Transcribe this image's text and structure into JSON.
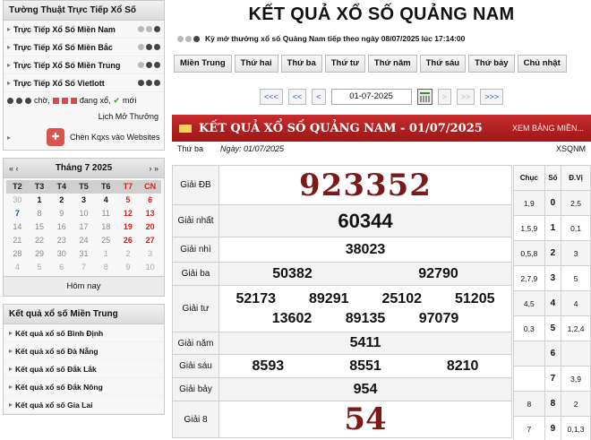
{
  "sidebar": {
    "live": {
      "title": "Tường Thuật Trực Tiếp Xổ Số",
      "items": [
        {
          "label": "Trực Tiếp Xổ Số Miền Nam"
        },
        {
          "label": "Trực Tiếp Xổ Số Miền Bắc"
        },
        {
          "label": "Trực Tiếp Xổ Số Miền Trung"
        },
        {
          "label": "Trực Tiếp Xổ Số Vietlott"
        }
      ],
      "legend_wait": "chờ,",
      "legend_live": "đang xổ,",
      "legend_new": "mới",
      "calendar_link": "Lịch Mở Thưởng",
      "embed_link": "Chèn Kqxs vào Websites"
    },
    "calendar": {
      "month_label": "Tháng 7 2025",
      "prev_year": "«",
      "prev_month": "‹",
      "next_month": "›",
      "next_year": "»",
      "dow": [
        "T2",
        "T3",
        "T4",
        "T5",
        "T6",
        "T7",
        "CN"
      ],
      "rows": [
        [
          "30",
          "1",
          "2",
          "3",
          "4",
          "5",
          "6"
        ],
        [
          "7",
          "8",
          "9",
          "10",
          "11",
          "12",
          "13"
        ],
        [
          "14",
          "15",
          "16",
          "17",
          "18",
          "19",
          "20"
        ],
        [
          "21",
          "22",
          "23",
          "24",
          "25",
          "26",
          "27"
        ],
        [
          "28",
          "29",
          "30",
          "31",
          "1",
          "2",
          "3"
        ],
        [
          "4",
          "5",
          "6",
          "7",
          "8",
          "9",
          "10"
        ]
      ],
      "today_button": "Hôm nay"
    },
    "mien_trung": {
      "title": "Kết quả xổ số Miền Trung",
      "items": [
        "Kết quả xổ số Bình Định",
        "Kết quả xổ số Đà Nẵng",
        "Kết quả xổ số Đắk Lắk",
        "Kết quả xổ số Đắk Nông",
        "Kết quả xổ số Gia Lai"
      ]
    }
  },
  "main": {
    "title": "KẾT QUẢ XỔ SỐ QUẢNG NAM",
    "info_text": "Kỳ mở thưởng xổ số Quảng Nam tiếp theo ngày 08/07/2025 lúc 17:14:00",
    "tabs": [
      "Miền Trung",
      "Thứ hai",
      "Thứ ba",
      "Thứ tư",
      "Thứ năm",
      "Thứ sáu",
      "Thứ bảy",
      "Chủ nhật"
    ],
    "pager": {
      "first": "<<<",
      "prev": "<<",
      "prev1": "<",
      "date_value": "01-07-2025",
      "next1": ">",
      "next": ">>",
      "last": ">>>"
    },
    "banner_title": "KẾT QUẢ XỔ SỐ QUẢNG NAM - 01/07/2025",
    "banner_link": "XEM BẢNG MIỀN...",
    "day": "Thứ ba",
    "date_text": "Ngày: 01/07/2025",
    "code": "XSQNM",
    "prizes": {
      "db": {
        "name": "Giải ĐB",
        "value": "923352"
      },
      "nhat": {
        "name": "Giải nhất",
        "value": "60344"
      },
      "nhi": {
        "name": "Giải nhì",
        "value": "38023"
      },
      "ba": {
        "name": "Giải ba",
        "values": [
          "50382",
          "92790"
        ]
      },
      "tu": {
        "name": "Giải tư",
        "values": [
          "52173",
          "89291",
          "25102",
          "51205",
          "13602",
          "89135",
          "97079"
        ]
      },
      "nam": {
        "name": "Giải năm",
        "value": "5411"
      },
      "sau": {
        "name": "Giải sáu",
        "values": [
          "8593",
          "8551",
          "8210"
        ]
      },
      "bay": {
        "name": "Giải bảy",
        "value": "954"
      },
      "tam": {
        "name": "Giải 8",
        "value": "54"
      }
    },
    "loto": {
      "headers": [
        "Chục",
        "Số",
        "Đ.Vị"
      ],
      "rows": [
        [
          "1,9",
          "0",
          "2,5"
        ],
        [
          "1,5,9",
          "1",
          "0,1"
        ],
        [
          "0,5,8",
          "2",
          "3"
        ],
        [
          "2,7,9",
          "3",
          "5"
        ],
        [
          "4,5",
          "4",
          "4"
        ],
        [
          "0,3",
          "5",
          "1,2,4"
        ],
        [
          "",
          "6",
          ""
        ],
        [
          "",
          "7",
          "3,9"
        ],
        [
          "8",
          "8",
          "2"
        ],
        [
          "7",
          "9",
          "0,1,3"
        ]
      ]
    }
  }
}
